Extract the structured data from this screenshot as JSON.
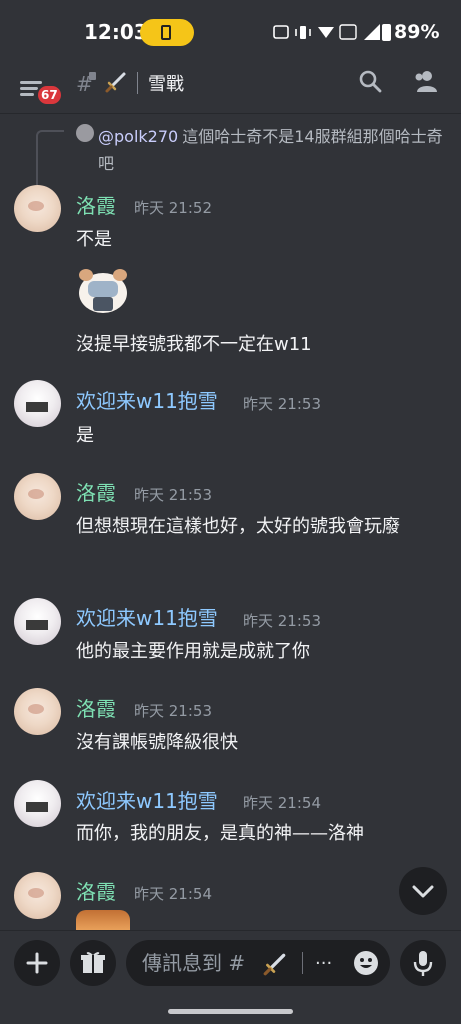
{
  "status_bar": {
    "time": "12:03",
    "battery_percent": "89%"
  },
  "header": {
    "notification_count": "67",
    "channel_name": "雪戰"
  },
  "reply": {
    "mention": "@polk270",
    "text": "這個哈士奇不是14服群組那個哈士奇吧"
  },
  "messages": [
    {
      "author": "洛霞",
      "time": "昨天 21:52",
      "lines": [
        "不是"
      ]
    },
    {
      "author": "洛霞",
      "time": "",
      "lines": [
        "沒提早接號我都不一定在w11"
      ]
    },
    {
      "author": "欢迎来w11抱雪",
      "time": "昨天 21:53",
      "lines": [
        "是"
      ]
    },
    {
      "author": "洛霞",
      "time": "昨天 21:53",
      "lines": [
        "但想想現在這樣也好，太好的號我會玩廢"
      ]
    },
    {
      "author": "欢迎来w11抱雪",
      "time": "昨天 21:53",
      "lines": [
        "他的最主要作用就是成就了你"
      ]
    },
    {
      "author": "洛霞",
      "time": "昨天 21:53",
      "lines": [
        "沒有課帳號降級很快"
      ]
    },
    {
      "author": "欢迎来w11抱雪",
      "time": "昨天 21:54",
      "lines": [
        "而你，我的朋友，是真的神——洛神"
      ]
    },
    {
      "author": "洛霞",
      "time": "昨天 21:54",
      "lines": []
    }
  ],
  "composer": {
    "placeholder": "傳訊息到 #",
    "ellipsis": "..."
  },
  "colors": {
    "background": "#313338",
    "input_bg": "#1e1f22",
    "name_luoxia": "#7ee0b3",
    "name_w11": "#8ec9ff",
    "badge_red": "#da373c",
    "battery_pill": "#f5c518"
  },
  "icons": [
    "menu-icon",
    "lock-icon",
    "sword-icon",
    "search-icon",
    "members-icon",
    "plus-icon",
    "gift-icon",
    "emoji-icon",
    "mic-icon",
    "chevron-down-icon"
  ]
}
